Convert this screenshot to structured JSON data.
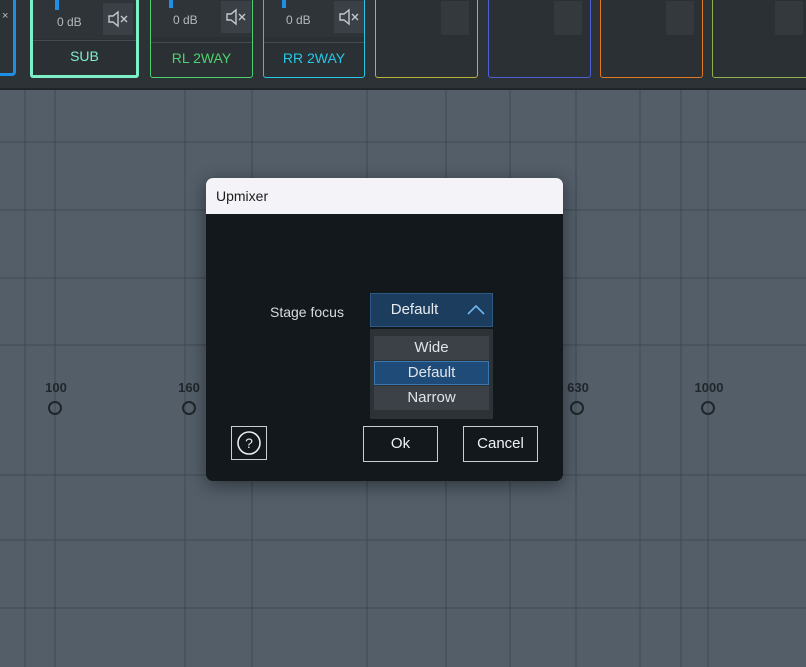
{
  "channels": [
    {
      "level": "0 dB",
      "name": "SUB",
      "color": "#7ef0c8"
    },
    {
      "level": "0 dB",
      "name": "RL 2WAY",
      "color": "#4fd06e"
    },
    {
      "level": "0 dB",
      "name": "RR 2WAY",
      "color": "#26c7e6"
    }
  ],
  "empty_channel_colors": [
    "#b8b235",
    "#4e5fd6",
    "#e07a22",
    "#8fb04a"
  ],
  "strip_left_close": "×",
  "frequency_labels": [
    "100",
    "160",
    "630",
    "1000"
  ],
  "dialog": {
    "title": "Upmixer",
    "field_label": "Stage focus",
    "selected_value": "Default",
    "options": [
      "Wide",
      "Default",
      "Narrow"
    ],
    "selected_index": 1,
    "ok_label": "Ok",
    "cancel_label": "Cancel",
    "help_symbol": "?"
  }
}
